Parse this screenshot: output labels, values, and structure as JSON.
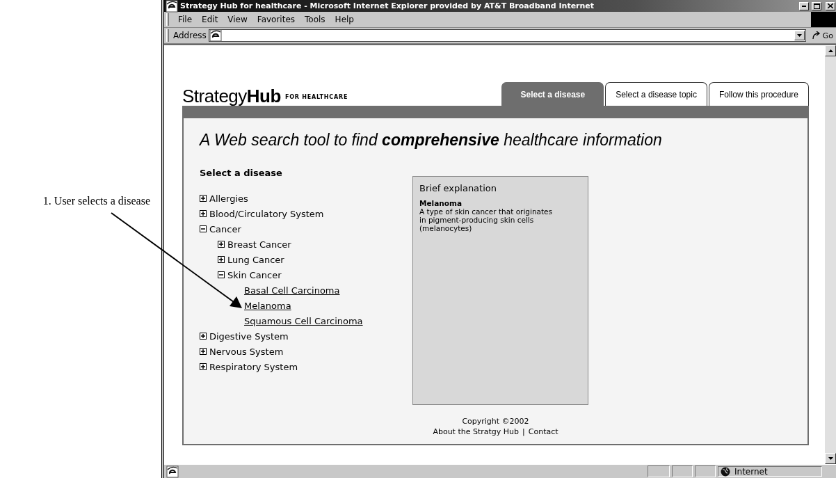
{
  "annotation": {
    "text": "1. User selects a disease"
  },
  "window": {
    "title": "Strategy Hub for healthcare - Microsoft Internet Explorer provided by AT&T Broadband Internet"
  },
  "menu": [
    "File",
    "Edit",
    "View",
    "Favorites",
    "Tools",
    "Help"
  ],
  "address_bar": {
    "label": "Address",
    "go": "Go"
  },
  "logo": {
    "name": "Strategy**Hub**",
    "tagline": "FOR HEALTHCARE"
  },
  "tabs": [
    {
      "label": "Select a disease",
      "selected": true
    },
    {
      "label": "Select a disease topic",
      "selected": false
    },
    {
      "label": "Follow this procedure",
      "selected": false
    }
  ],
  "headline": "A Web search tool to find **comprehensive** healthcare information",
  "section_title": "Select a disease",
  "tree": [
    {
      "label": "Allergies",
      "kind": "group",
      "expanded": false
    },
    {
      "label": "Blood/Circulatory System",
      "kind": "group",
      "expanded": false
    },
    {
      "label": "Cancer",
      "kind": "group",
      "expanded": true,
      "children": [
        {
          "label": "Breast Cancer",
          "kind": "group",
          "expanded": false
        },
        {
          "label": "Lung Cancer",
          "kind": "group",
          "expanded": false
        },
        {
          "label": "Skin Cancer",
          "kind": "group",
          "expanded": true,
          "children": [
            {
              "label": "Basal Cell Carcinoma",
              "kind": "link"
            },
            {
              "label": "Melanoma",
              "kind": "link"
            },
            {
              "label": "Squamous Cell Carcinoma",
              "kind": "link"
            }
          ]
        }
      ]
    },
    {
      "label": "Digestive System",
      "kind": "group",
      "expanded": false
    },
    {
      "label": "Nervous System",
      "kind": "group",
      "expanded": false
    },
    {
      "label": "Respiratory System",
      "kind": "group",
      "expanded": false
    }
  ],
  "explanation": {
    "title": "Brief explanation",
    "term": "Melanoma",
    "text": "A type of skin cancer that originates in pigment-producing skin cells (melanocytes)"
  },
  "footer": {
    "copyright": "Copyright ©2002",
    "links": [
      "About the Stratgy Hub",
      "Contact"
    ],
    "separator": "|"
  },
  "status_bar": {
    "zone": "Internet"
  }
}
